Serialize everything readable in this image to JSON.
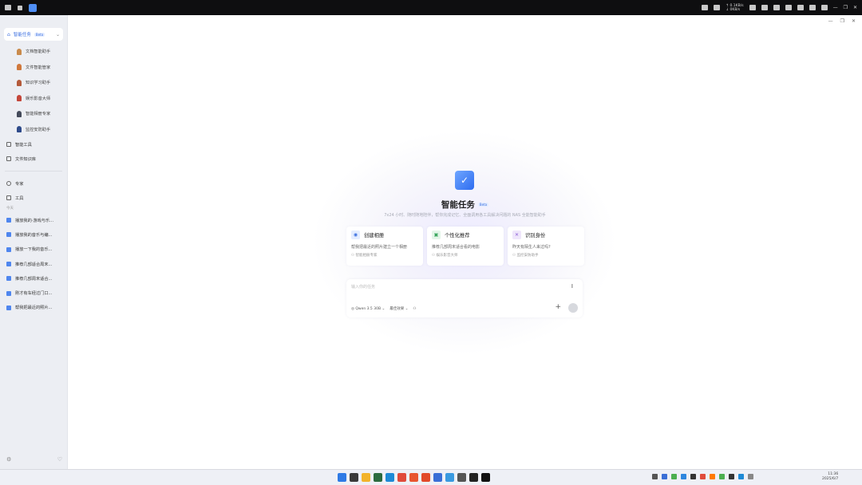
{
  "topbar": {
    "net_up": "↑ 0.1KB/s",
    "net_down": "↓ 0KB/s"
  },
  "sidebar": {
    "header_label": "智能任务",
    "header_badge": "Beta",
    "agents": [
      {
        "label": "文档智能助手",
        "color": "#c98a4b"
      },
      {
        "label": "文件智能管家",
        "color": "#d0783c"
      },
      {
        "label": "知识学习助手",
        "color": "#b45a3a"
      },
      {
        "label": "娱乐影音大师",
        "color": "#c4463a"
      },
      {
        "label": "智能相册专家",
        "color": "#444a5a"
      },
      {
        "label": "监控安防助手",
        "color": "#2e4a8a"
      }
    ],
    "items": [
      {
        "label": "智能工具"
      },
      {
        "label": "文件知识库"
      }
    ],
    "items2": [
      {
        "label": "专家"
      },
      {
        "label": "工具"
      }
    ],
    "section_label": "今天",
    "chats": [
      {
        "label": "播放我的·游戏与乐..."
      },
      {
        "label": "播放我的音乐与编..."
      },
      {
        "label": "播放一下我的音乐..."
      },
      {
        "label": "推荐几部适合周末..."
      },
      {
        "label": "推荐几部周末适合..."
      },
      {
        "label": "刚才有车经过门口..."
      },
      {
        "label": "帮我把最近的照片..."
      }
    ]
  },
  "main": {
    "title": "智能任务",
    "title_badge": "Beta",
    "subtitle": "7x24 小时、随时随地陪伴，帮你完成记忆、全面调用各工具解决问题的 NAS 全能智能助手",
    "cards": [
      {
        "title": "创建相册",
        "desc": "帮我把最近的照片建立一个相册",
        "source": "智能相册专家",
        "icon_bg": "#e4edff",
        "icon_color": "#3b6fe0"
      },
      {
        "title": "个性化推荐",
        "desc": "推荐几部周末适合看的电影",
        "source": "娱乐影音大师",
        "icon_bg": "#e3f6e8",
        "icon_color": "#37a55b"
      },
      {
        "title": "识别身份",
        "desc": "昨天有陌生人来过吗?",
        "source": "监控安防助手",
        "icon_bg": "#efe6fb",
        "icon_color": "#8a5cd6"
      }
    ],
    "input_placeholder": "输入你的任务",
    "model_label": "Qwen 3.5 30B",
    "mode_label": "最佳效果"
  },
  "taskbar": {
    "time": "11:36",
    "date": "2025/6/7",
    "apps": [
      "#2f7ae5",
      "#3a3a3a",
      "#f2b32b",
      "#2c6b3f",
      "#1e8ad6",
      "#e04b3b",
      "#e8552f",
      "#e24a2a",
      "#3a6fd6",
      "#3a9ae0",
      "#555555",
      "#222222",
      "#111111"
    ],
    "tray": [
      "#555",
      "#3a6fd6",
      "#4caf50",
      "#2e86de",
      "#333",
      "#e04b3b",
      "#ff7a00",
      "#4caf50",
      "#333",
      "#1e8ad6",
      "#888"
    ]
  }
}
